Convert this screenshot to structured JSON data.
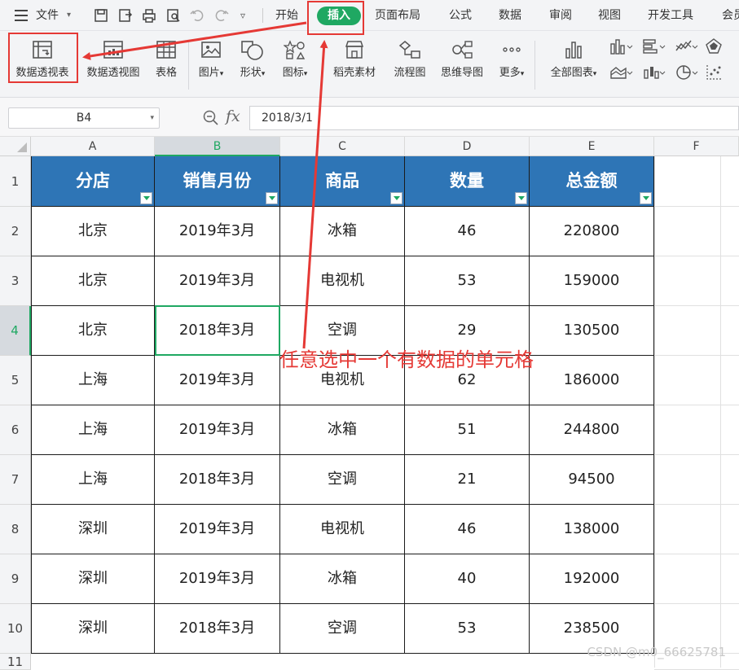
{
  "menu": {
    "file_label": "文件",
    "tabs": [
      "开始",
      "插入",
      "页面布局",
      "公式",
      "数据",
      "审阅",
      "视图",
      "开发工具",
      "会员"
    ],
    "active_tab": "插入"
  },
  "ribbon": {
    "buttons": [
      "数据透视表",
      "数据透视图",
      "表格",
      "图片",
      "形状",
      "图标",
      "稻壳素材",
      "流程图",
      "思维导图",
      "更多",
      "全部图表"
    ]
  },
  "formula_bar": {
    "cell_ref": "B4",
    "fx_symbol": "fx",
    "content": "2018/3/1"
  },
  "grid": {
    "column_headers": [
      "A",
      "B",
      "C",
      "D",
      "E",
      "F"
    ],
    "row_headers": [
      "1",
      "2",
      "3",
      "4",
      "5",
      "6",
      "7",
      "8",
      "9",
      "10",
      "11"
    ],
    "selected_cell": "B4"
  },
  "table": {
    "headers": [
      "分店",
      "销售月份",
      "商品",
      "数量",
      "总金额"
    ],
    "rows": [
      [
        "北京",
        "2019年3月",
        "冰箱",
        "46",
        "220800"
      ],
      [
        "北京",
        "2019年3月",
        "电视机",
        "53",
        "159000"
      ],
      [
        "北京",
        "2018年3月",
        "空调",
        "29",
        "130500"
      ],
      [
        "上海",
        "2019年3月",
        "电视机",
        "62",
        "186000"
      ],
      [
        "上海",
        "2019年3月",
        "冰箱",
        "51",
        "244800"
      ],
      [
        "上海",
        "2018年3月",
        "空调",
        "21",
        "94500"
      ],
      [
        "深圳",
        "2019年3月",
        "电视机",
        "46",
        "138000"
      ],
      [
        "深圳",
        "2019年3月",
        "冰箱",
        "40",
        "192000"
      ],
      [
        "深圳",
        "2018年3月",
        "空调",
        "53",
        "238500"
      ]
    ]
  },
  "annotation": {
    "text": "任意选中一个有数据的单元格",
    "color": "#e53935"
  },
  "watermark": "CSDN @m0_66625781",
  "colors": {
    "accent": "#1fa862",
    "header_fill": "#2e75b6",
    "annotation": "#e53935"
  }
}
